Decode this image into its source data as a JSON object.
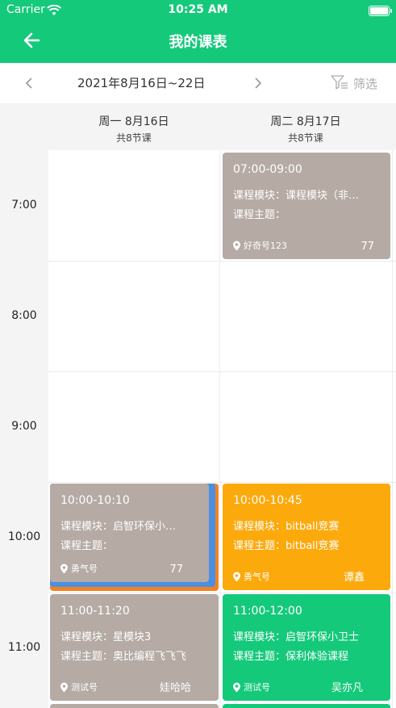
{
  "status_bar": {
    "carrier": "Carrier",
    "time": "10:25 AM"
  },
  "header": {
    "title": "我的课表"
  },
  "date_bar": {
    "range": "2021年8月16日~22日",
    "filter_label": "筛选"
  },
  "days": [
    {
      "date": "周一  8月16日",
      "count": "共8节课"
    },
    {
      "date": "周二  8月17日",
      "count": "共8节课"
    }
  ],
  "times": [
    "7:00",
    "8:00",
    "9:00",
    "10:00",
    "11:00"
  ],
  "cards": [
    {
      "time": "07:00-09:00",
      "module": "课程模块：课程模块（非…",
      "topic": "课程主题：",
      "location": "好奇号123",
      "teacher": "77"
    },
    {
      "time": "10:00-10:10",
      "module": "课程模块：启智环保小…",
      "topic": "课程主题：",
      "location": "勇气号",
      "teacher": "77"
    },
    {
      "time": "10:00-10:45",
      "module": "课程模块：bitball竞赛",
      "topic": "课程主题：bitball竞赛",
      "location": "勇气号",
      "teacher": "谭鑫"
    },
    {
      "time": "11:00-11:20",
      "module": "课程模块：星模块3",
      "topic": "课程主题：奥比编程飞飞飞",
      "location": "测试号",
      "teacher": "娃哈哈"
    },
    {
      "time": "11:00-12:00",
      "module": "课程模块：启智环保小卫士",
      "topic": "课程主题：保利体验课程",
      "location": "测试号",
      "teacher": "吴亦凡"
    }
  ],
  "colors": {
    "brand_green": "#15c97b",
    "card_gray": "#b5aaa4",
    "card_orange": "#fca90c",
    "accent_blue": "#4a90e2",
    "accent_orange": "#f5821f"
  }
}
